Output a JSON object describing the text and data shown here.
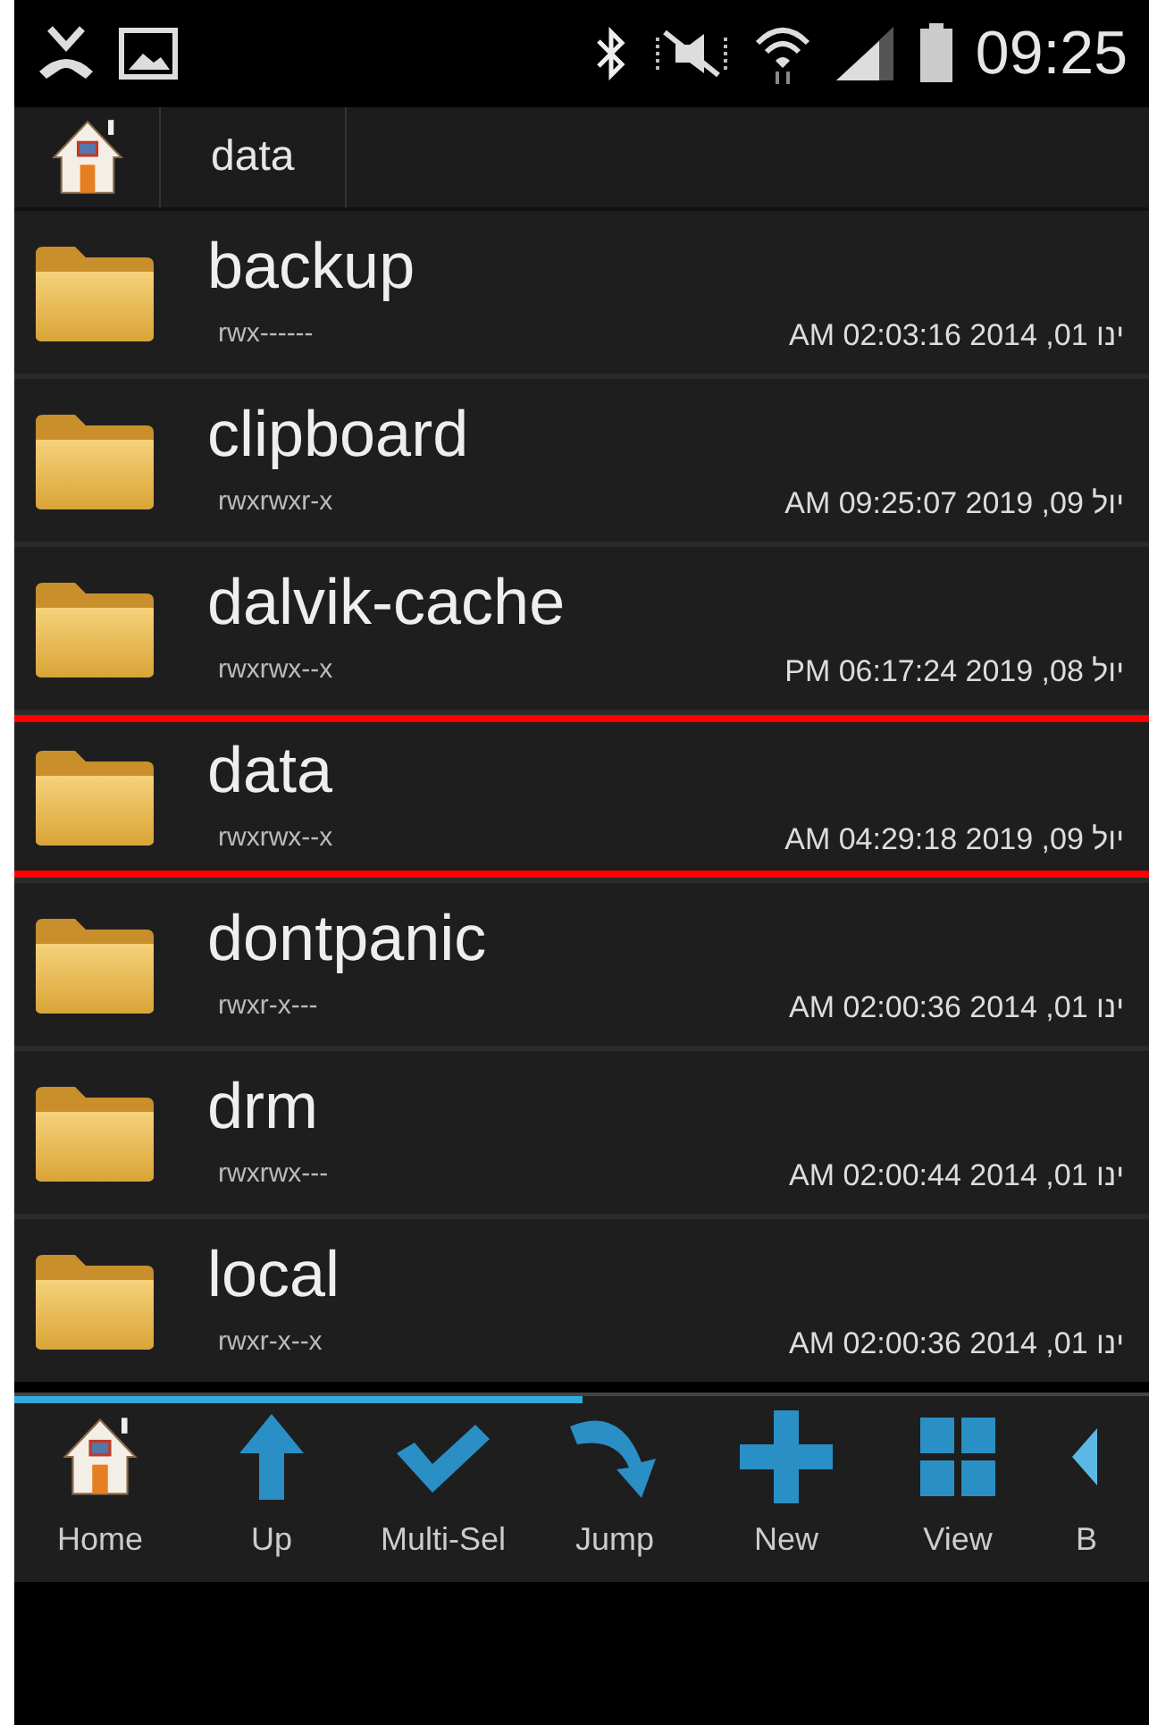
{
  "status_bar": {
    "time": "09:25"
  },
  "breadcrumb": {
    "items": [
      "data"
    ]
  },
  "files": [
    {
      "name": "backup",
      "permissions": "rwx------",
      "modified": "AM 02:03:16 2014 ,01 ינו",
      "highlighted": false
    },
    {
      "name": "clipboard",
      "permissions": "rwxrwxr-x",
      "modified": "AM 09:25:07 2019 ,09 יול",
      "highlighted": false
    },
    {
      "name": "dalvik-cache",
      "permissions": "rwxrwx--x",
      "modified": "PM 06:17:24 2019 ,08 יול",
      "highlighted": false
    },
    {
      "name": "data",
      "permissions": "rwxrwx--x",
      "modified": "AM 04:29:18 2019 ,09 יול",
      "highlighted": true
    },
    {
      "name": "dontpanic",
      "permissions": "rwxr-x---",
      "modified": "AM 02:00:36 2014 ,01 ינו",
      "highlighted": false
    },
    {
      "name": "drm",
      "permissions": "rwxrwx---",
      "modified": "AM 02:00:44 2014 ,01 ינו",
      "highlighted": false
    },
    {
      "name": "local",
      "permissions": "rwxr-x--x",
      "modified": "AM 02:00:36 2014 ,01 ינו",
      "highlighted": false
    }
  ],
  "toolbar": {
    "level": 0.5,
    "buttons": [
      {
        "kind": "home",
        "label": "Home"
      },
      {
        "kind": "up",
        "label": "Up"
      },
      {
        "kind": "multisel",
        "label": "Multi-Sel"
      },
      {
        "kind": "jump",
        "label": "Jump"
      },
      {
        "kind": "new",
        "label": "New"
      },
      {
        "kind": "view",
        "label": "View"
      },
      {
        "kind": "back",
        "label": "B"
      }
    ]
  }
}
